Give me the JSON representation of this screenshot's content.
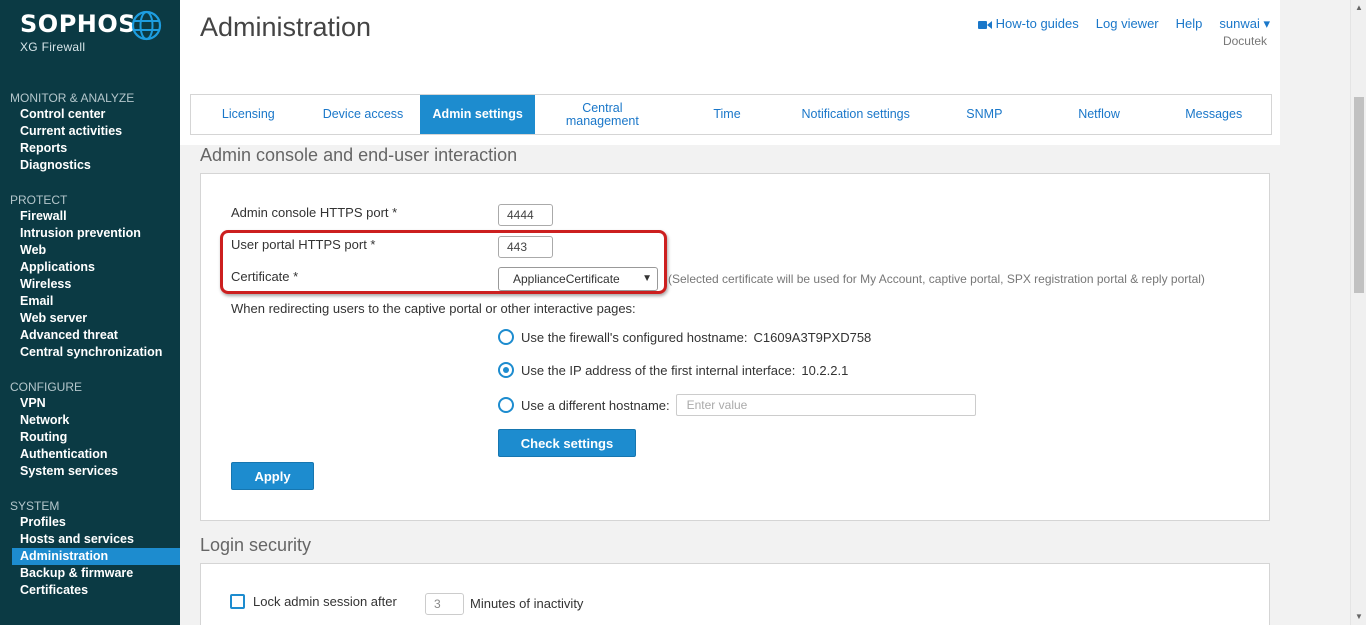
{
  "brand": {
    "name": "SOPHOS",
    "product": "XG Firewall"
  },
  "sidebar": {
    "sections": [
      {
        "heading": "MONITOR & ANALYZE",
        "items": [
          "Control center",
          "Current activities",
          "Reports",
          "Diagnostics"
        ]
      },
      {
        "heading": "PROTECT",
        "items": [
          "Firewall",
          "Intrusion prevention",
          "Web",
          "Applications",
          "Wireless",
          "Email",
          "Web server",
          "Advanced threat",
          "Central synchronization"
        ]
      },
      {
        "heading": "CONFIGURE",
        "items": [
          "VPN",
          "Network",
          "Routing",
          "Authentication",
          "System services"
        ]
      },
      {
        "heading": "SYSTEM",
        "items": [
          "Profiles",
          "Hosts and services",
          "Administration",
          "Backup & firmware",
          "Certificates"
        ]
      }
    ],
    "active_item": "Administration"
  },
  "header": {
    "title": "Administration",
    "links": {
      "howto": "How-to guides",
      "logviewer": "Log viewer",
      "help": "Help",
      "user": "sunwai ▾"
    },
    "company": "Docutek"
  },
  "tabs": [
    {
      "label": "Licensing",
      "active": false
    },
    {
      "label": "Device access",
      "active": false
    },
    {
      "label": "Admin settings",
      "active": true
    },
    {
      "label": "Central management",
      "active": false
    },
    {
      "label": "Time",
      "active": false
    },
    {
      "label": "Notification settings",
      "active": false
    },
    {
      "label": "SNMP",
      "active": false
    },
    {
      "label": "Netflow",
      "active": false
    },
    {
      "label": "Messages",
      "active": false
    }
  ],
  "admin_console": {
    "section_title": "Admin console and end-user interaction",
    "https_port_label": "Admin console HTTPS port *",
    "https_port_value": "4444",
    "user_portal_label": "User portal HTTPS port *",
    "user_portal_value": "443",
    "certificate_label": "Certificate *",
    "certificate_value": "ApplianceCertificate",
    "certificate_hint": "(Selected certificate will be used for My Account, captive portal, SPX registration portal & reply portal)",
    "redirect_label": "When redirecting users to the captive portal or other interactive pages:",
    "option_hostname_label": "Use the firewall's configured hostname:",
    "option_hostname_value": "C1609A3T9PXD758",
    "option_ip_label": "Use the IP address of the first internal interface:",
    "option_ip_value": "10.2.2.1",
    "option_different_label": "Use a different hostname:",
    "option_different_placeholder": "Enter value",
    "selected_option": "ip",
    "check_settings_label": "Check settings",
    "apply_label": "Apply"
  },
  "login_security": {
    "section_title": "Login security",
    "lock_label": "Lock admin session after",
    "lock_minutes": "3",
    "lock_suffix": "Minutes of inactivity"
  },
  "colors": {
    "sidebar_bg": "#0b3a44",
    "accent": "#1d8ccf",
    "link": "#1a77c9",
    "highlight": "#cc1f1f"
  }
}
